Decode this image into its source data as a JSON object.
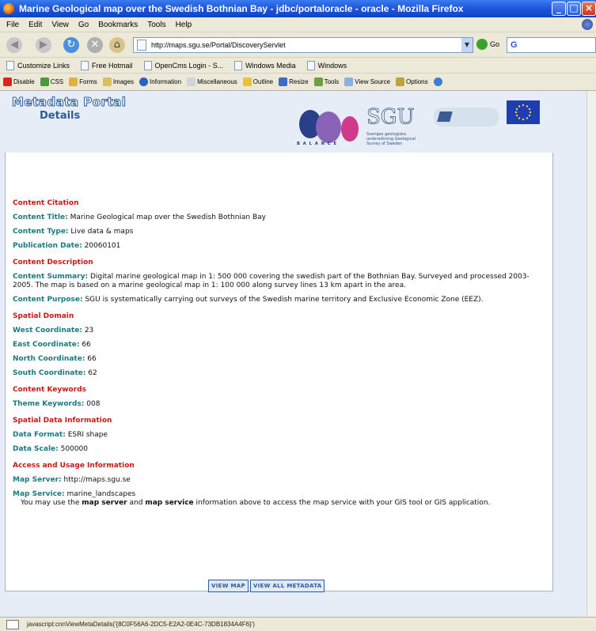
{
  "window": {
    "title": "Marine Geological map over the Swedish Bothnian Bay - jdbc/portaloracle - oracle - Mozilla Firefox"
  },
  "menu": [
    "File",
    "Edit",
    "View",
    "Go",
    "Bookmarks",
    "Tools",
    "Help"
  ],
  "navbar": {
    "url": "http://maps.sgu.se/Portal/DiscoveryServlet",
    "go_label": "Go"
  },
  "bookmarks": [
    "Customize Links",
    "Free Hotmail",
    "OpenCms Login - S...",
    "Windows Media",
    "Windows"
  ],
  "devbar": [
    "Disable",
    "CSS",
    "Forms",
    "Images",
    "Information",
    "Miscellaneous",
    "Outline",
    "Resize",
    "Tools",
    "View Source",
    "Options"
  ],
  "header": {
    "portal_title": "Metadata Portal",
    "portal_subtitle": "Details",
    "balance_text": "BALANCE",
    "sgu_text": "SGU",
    "sgu_sub": "Sveriges geologiska undersökning Geological Survey of Sweden"
  },
  "details": {
    "citation": {
      "heading": "Content Citation",
      "title_label": "Content Title:",
      "title_value": "Marine Geological map over the Swedish Bothnian Bay",
      "type_label": "Content Type:",
      "type_value": "Live data & maps",
      "date_label": "Publication Date:",
      "date_value": "20060101"
    },
    "description": {
      "heading": "Content Description",
      "summary_label": "Content Summary:",
      "summary_value": "Digital marine geological map in 1: 500 000 covering the swedish part of the Bothnian Bay. Surveyed and processed 2003-2005. The map is based on a marine geological map in 1: 100 000 along survey lines 13 km apart in the area.",
      "purpose_label": "Content Purpose:",
      "purpose_value": "SGU is systematically carrying out surveys of the Swedish marine territory and Exclusive Economic Zone (EEZ)."
    },
    "spatial": {
      "heading": "Spatial Domain",
      "west_label": "West Coordinate:",
      "west_value": "23",
      "east_label": "East Coordinate:",
      "east_value": "66",
      "north_label": "North Coordinate:",
      "north_value": "66",
      "south_label": "South Coordinate:",
      "south_value": "62"
    },
    "keywords": {
      "heading": "Content Keywords",
      "theme_label": "Theme Keywords:",
      "theme_value": "008"
    },
    "data_info": {
      "heading": "Spatial Data Information",
      "format_label": "Data Format:",
      "format_value": "ESRI shape",
      "scale_label": "Data Scale:",
      "scale_value": "500000"
    },
    "access": {
      "heading": "Access and Usage Information",
      "server_label": "Map Server:",
      "server_value": "http://maps.sgu.se",
      "service_label": "Map Service:",
      "service_value": "marine_landscapes",
      "note_pre": "You may use the",
      "note_bold1": "map server",
      "note_mid": "and",
      "note_bold2": "map service",
      "note_post": "information above to access the map service with your GIS tool or GIS application."
    }
  },
  "buttons": {
    "view_map": "VIEW MAP",
    "view_all": "VIEW ALL METADATA"
  },
  "status": {
    "text": "javascript:cnnViewMetaDetails('{8C0F56A6-2DC5-E2A2-0E4C-73DB1834A4F6}')"
  },
  "colors": {
    "section_heading": "#c41a1a",
    "label": "#1a7a82",
    "portal_blue": "#2d5b9c"
  }
}
